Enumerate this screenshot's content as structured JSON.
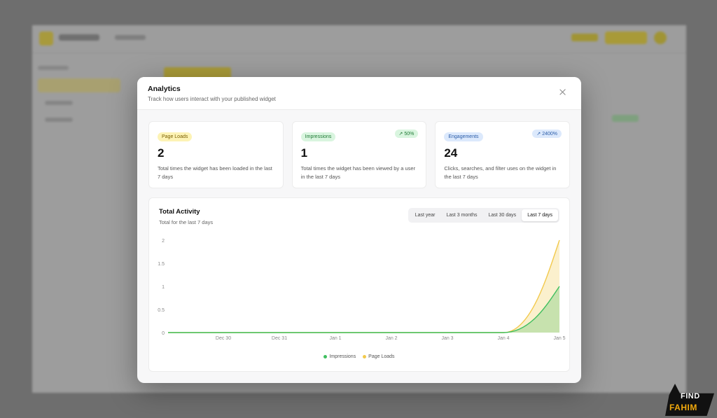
{
  "modal": {
    "title": "Analytics",
    "subtitle": "Track how users interact with your published widget"
  },
  "stats": [
    {
      "badge": "Page Loads",
      "value": "2",
      "trend": "",
      "description": "Total times the widget has been loaded in the last 7 days",
      "color": "#fdf3b5"
    },
    {
      "badge": "Impressions",
      "value": "1",
      "trend": "↗ 50%",
      "description": "Total times the widget has been viewed by a user in the last 7 days",
      "color": "#d9f5df"
    },
    {
      "badge": "Engagements",
      "value": "24",
      "trend": "↗ 2400%",
      "description": "Clicks, searches, and filter uses on the widget in the last 7 days",
      "color": "#dce9fc"
    }
  ],
  "chart": {
    "title": "Total Activity",
    "subtitle": "Total for the last 7 days",
    "ranges": [
      "Last year",
      "Last 3 months",
      "Last 30 days",
      "Last 7 days"
    ],
    "active_range": "Last 7 days"
  },
  "chart_data": {
    "type": "area",
    "x": [
      "Dec 30",
      "Dec 31",
      "Jan 1",
      "Jan 2",
      "Jan 3",
      "Jan 4",
      "Jan 5"
    ],
    "y_ticks": [
      "0",
      "0.5",
      "1",
      "1.5",
      "2"
    ],
    "ylim": [
      0,
      2
    ],
    "grid": false,
    "legend_position": "bottom",
    "series": [
      {
        "name": "Impressions",
        "values": [
          0,
          0,
          0,
          0,
          0,
          0,
          1
        ],
        "color": "#3fbf5f"
      },
      {
        "name": "Page Loads",
        "values": [
          0,
          0,
          0,
          0,
          0,
          0,
          2
        ],
        "color": "#f2c94c"
      }
    ]
  },
  "watermark": {
    "line1": "FIND",
    "line2": "FAHIM"
  }
}
